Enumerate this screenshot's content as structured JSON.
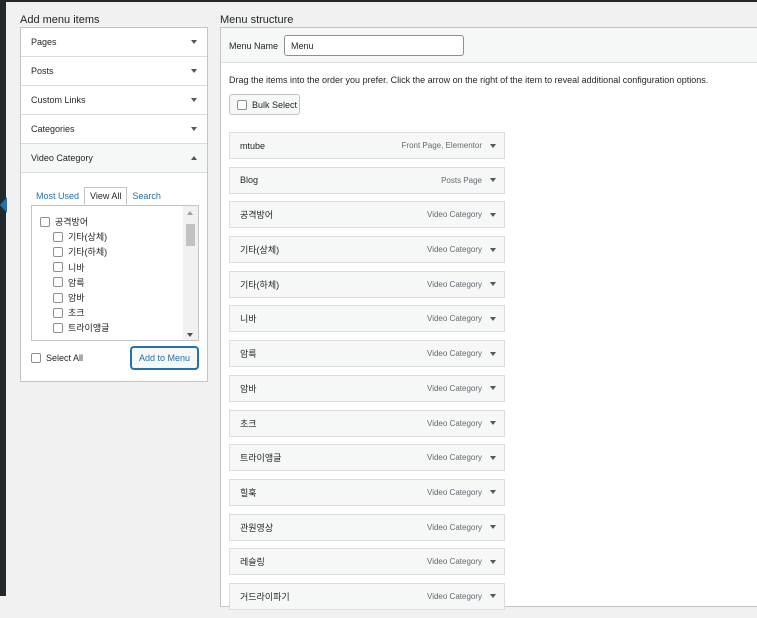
{
  "left_title": "Add menu items",
  "right_title": "Menu structure",
  "accordion": {
    "sections": [
      "Pages",
      "Posts",
      "Custom Links",
      "Categories"
    ],
    "open_section": "Video Category",
    "tabs": [
      "Most Used",
      "View All",
      "Search"
    ],
    "active_tab": "View All",
    "tree_root": "공격방어",
    "tree_children": [
      "기타(상체)",
      "기타(하체)",
      "니바",
      "암륵",
      "암바",
      "초크",
      "트라이앵글"
    ],
    "select_all": "Select All",
    "add_button": "Add to Menu"
  },
  "structure": {
    "menu_name_label": "Menu Name",
    "menu_name_value": "Menu",
    "instructions": "Drag the items into the order you prefer. Click the arrow on the right of the item to reveal additional configuration options.",
    "bulk_select": "Bulk Select",
    "items": [
      {
        "title": "mtube",
        "type": "Front Page, Elementor"
      },
      {
        "title": "Blog",
        "type": "Posts Page"
      },
      {
        "title": "공격방어",
        "type": "Video Category"
      },
      {
        "title": "기타(상체)",
        "type": "Video Category"
      },
      {
        "title": "기타(하체)",
        "type": "Video Category"
      },
      {
        "title": "니바",
        "type": "Video Category"
      },
      {
        "title": "암륵",
        "type": "Video Category"
      },
      {
        "title": "암바",
        "type": "Video Category"
      },
      {
        "title": "초크",
        "type": "Video Category"
      },
      {
        "title": "트라이앵글",
        "type": "Video Category"
      },
      {
        "title": "힐훅",
        "type": "Video Category"
      },
      {
        "title": "관원영상",
        "type": "Video Category"
      },
      {
        "title": "레슬링",
        "type": "Video Category"
      },
      {
        "title": "거드라이파기",
        "type": "Video Category"
      }
    ]
  },
  "colors": {
    "link": "#2271b1",
    "admin_bar": "#23282d",
    "border": "#c3c4c7"
  },
  "icons": {
    "collapse": "chevron-down-icon",
    "expand": "chevron-up-icon"
  }
}
